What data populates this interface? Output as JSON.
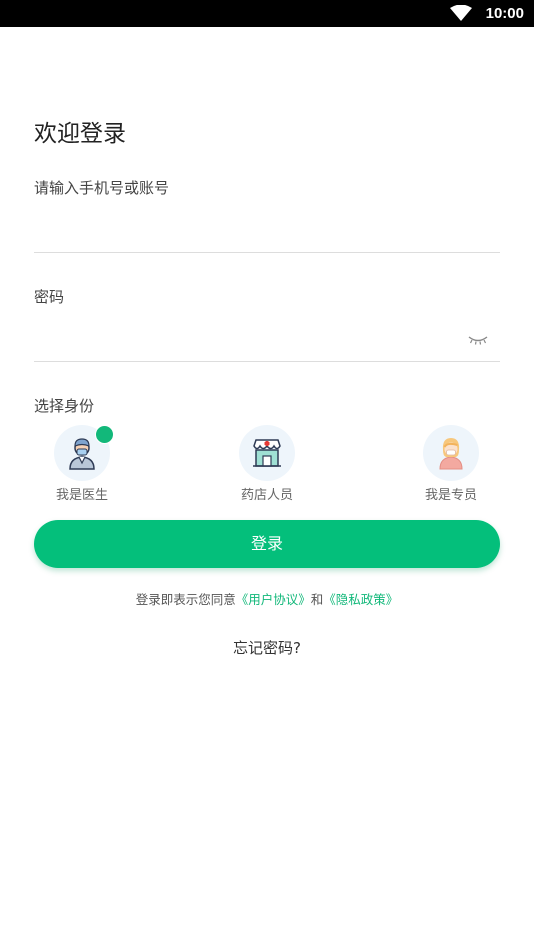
{
  "status_bar": {
    "time": "10:00",
    "wifi_icon": "wifi-icon"
  },
  "login": {
    "title": "欢迎登录",
    "account_placeholder": "请输入手机号或账号",
    "account_value": "",
    "password_label": "密码",
    "password_value": "",
    "eye_icon": "eye-closed-icon"
  },
  "roles": {
    "label": "选择身份",
    "selected": "doctor",
    "items": [
      {
        "key": "doctor",
        "label": "我是医生",
        "icon": "doctor-icon"
      },
      {
        "key": "pharmacy",
        "label": "药店人员",
        "icon": "pharmacy-icon"
      },
      {
        "key": "specialist",
        "label": "我是专员",
        "icon": "specialist-icon"
      }
    ]
  },
  "button": {
    "login_label": "登录"
  },
  "agreement": {
    "prefix": "登录即表示您同意",
    "user_agreement": "《用户协议》",
    "and": "和",
    "privacy_policy": "《隐私政策》"
  },
  "forgot_password": "忘记密码?",
  "colors": {
    "accent": "#04bf7b",
    "link": "#12b87a",
    "status_bar": "#000000"
  }
}
